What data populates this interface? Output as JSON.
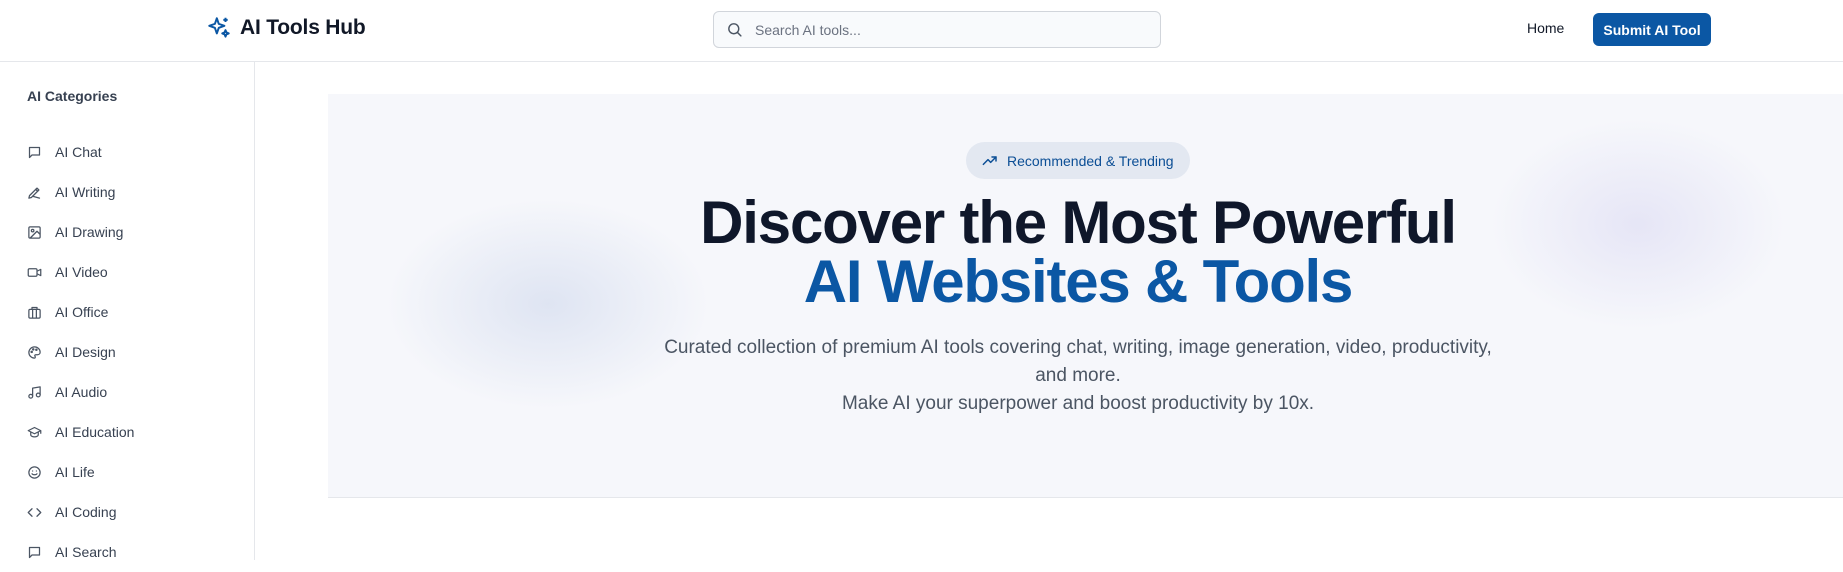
{
  "header": {
    "logo_text": "AI Tools Hub",
    "search_placeholder": "Search AI tools...",
    "nav_home": "Home",
    "submit_label": "Submit AI Tool"
  },
  "sidebar": {
    "title": "AI Categories",
    "items": [
      {
        "label": "AI Chat",
        "icon": "chat-icon"
      },
      {
        "label": "AI Writing",
        "icon": "pen-icon"
      },
      {
        "label": "AI Drawing",
        "icon": "image-icon"
      },
      {
        "label": "AI Video",
        "icon": "video-icon"
      },
      {
        "label": "AI Office",
        "icon": "briefcase-icon"
      },
      {
        "label": "AI Design",
        "icon": "palette-icon"
      },
      {
        "label": "AI Audio",
        "icon": "music-icon"
      },
      {
        "label": "AI Education",
        "icon": "graduation-cap-icon"
      },
      {
        "label": "AI Life",
        "icon": "smile-icon"
      },
      {
        "label": "AI Coding",
        "icon": "code-icon"
      },
      {
        "label": "AI Search",
        "icon": "chat-icon"
      }
    ]
  },
  "hero": {
    "badge": "Recommended & Trending",
    "title_line1": "Discover the Most Powerful",
    "title_line2": "AI Websites & Tools",
    "desc_line1": "Curated collection of premium AI tools covering chat, writing, image generation, video, productivity, and more.",
    "desc_line2": "Make AI your superpower and boost productivity by 10x."
  },
  "colors": {
    "brand": "#0b57a4",
    "hero_bg": "#f6f7fb",
    "badge_bg": "#e3e8f1"
  }
}
